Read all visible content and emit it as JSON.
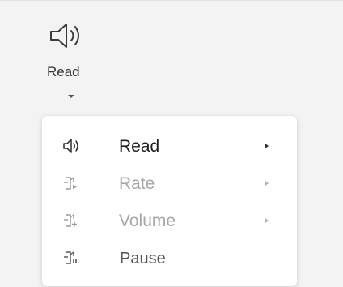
{
  "ribbon": {
    "read_button": {
      "label": "Read",
      "icon": "speaker-icon"
    }
  },
  "menu": {
    "items": [
      {
        "label": "Read",
        "icon": "speaker-icon",
        "enabled": true,
        "has_submenu": true
      },
      {
        "label": "Rate",
        "icon": "rate-icon",
        "enabled": false,
        "has_submenu": true
      },
      {
        "label": "Volume",
        "icon": "volume-icon",
        "enabled": false,
        "has_submenu": true
      },
      {
        "label": "Pause",
        "icon": "pause-icon",
        "enabled": true,
        "has_submenu": false
      }
    ]
  },
  "colors": {
    "ribbon_bg": "#f3f3f3",
    "menu_bg": "#ffffff",
    "text": "#1f1f1f",
    "disabled_text": "#a6a6a6"
  }
}
